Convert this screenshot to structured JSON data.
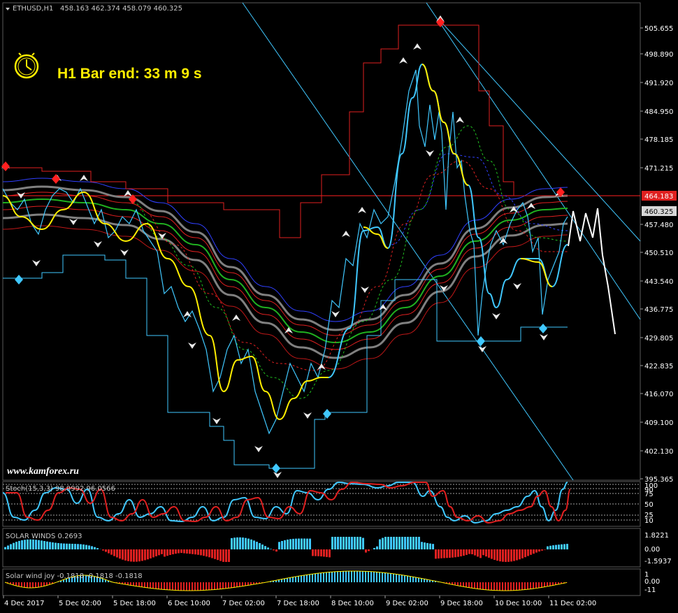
{
  "header": {
    "symbol": "ETHUSD,H1",
    "ohlc": "458.163 462.374 458.079 460.325"
  },
  "timer": {
    "text": "H1 Bar end: 33 m 9 s",
    "icon": "clock-icon"
  },
  "watermark": "www.kamforex.ru",
  "price_axis": {
    "ticks": [
      "505.655",
      "498.890",
      "491.920",
      "484.950",
      "478.185",
      "471.215",
      "457.480",
      "450.510",
      "443.540",
      "436.775",
      "429.805",
      "422.835",
      "416.070",
      "409.100",
      "402.130",
      "395.365"
    ],
    "current_price": "460.325",
    "resistance_price": "464.183"
  },
  "time_axis": {
    "labels": [
      "4 Dec 2017",
      "5 Dec 02:00",
      "5 Dec 18:00",
      "6 Dec 10:00",
      "7 Dec 02:00",
      "7 Dec 18:00",
      "8 Dec 10:00",
      "9 Dec 02:00",
      "9 Dec 18:00",
      "10 Dec 10:00",
      "11 Dec 02:00"
    ]
  },
  "stoch": {
    "label": "Stoch(15,3,3) 98.9992 96.0566",
    "levels": [
      "100",
      "90",
      "75",
      "50",
      "25",
      "10",
      "0"
    ]
  },
  "solar_winds": {
    "label": "SOLAR WINDS 0.2693",
    "levels": [
      "1.8221",
      "0.00",
      "-1.5937"
    ]
  },
  "solar_wind_joy": {
    "label": "Solar wind joy -0.1818 -0.1818 -0.1818",
    "levels": [
      "1",
      "0.00",
      "-11"
    ]
  },
  "colors": {
    "background": "#000000",
    "price_line": "#ff2020",
    "cyan": "#40c8ff",
    "yellow": "#ffee00",
    "grid": "#2a2a2a"
  }
}
